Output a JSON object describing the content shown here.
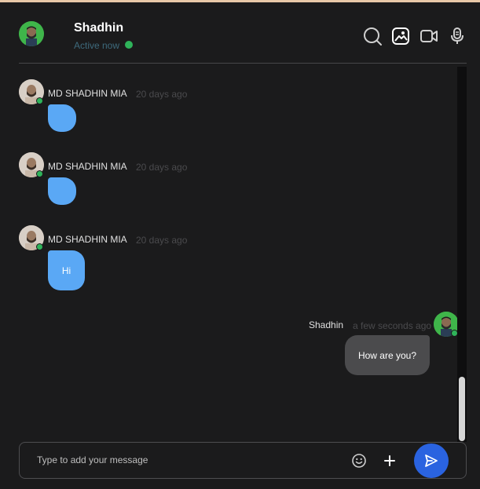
{
  "header": {
    "name": "Shadhin",
    "status": "Active now",
    "icons": [
      "search-icon",
      "gallery-icon",
      "video-call-icon",
      "microphone-icon"
    ]
  },
  "messages": [
    {
      "direction": "incoming",
      "sender": "MD SHADHIN MIA",
      "time": "20 days ago",
      "text": ""
    },
    {
      "direction": "incoming",
      "sender": "MD SHADHIN MIA",
      "time": "20 days ago",
      "text": ""
    },
    {
      "direction": "incoming",
      "sender": "MD SHADHIN MIA",
      "time": "20 days ago",
      "text": "Hi"
    },
    {
      "direction": "outgoing",
      "sender": "Shadhin",
      "time": "a few seconds ago",
      "text": "How are you?"
    }
  ],
  "composer": {
    "placeholder": "Type to add your message",
    "value": "",
    "icons": [
      "emoji-icon",
      "plus-icon",
      "send-icon"
    ]
  },
  "colors": {
    "background": "#1b1b1c",
    "incoming_bubble": "#5aa8f5",
    "outgoing_bubble": "#4b4b4d",
    "online": "#2fb35a",
    "send_button": "#2a63e0"
  }
}
